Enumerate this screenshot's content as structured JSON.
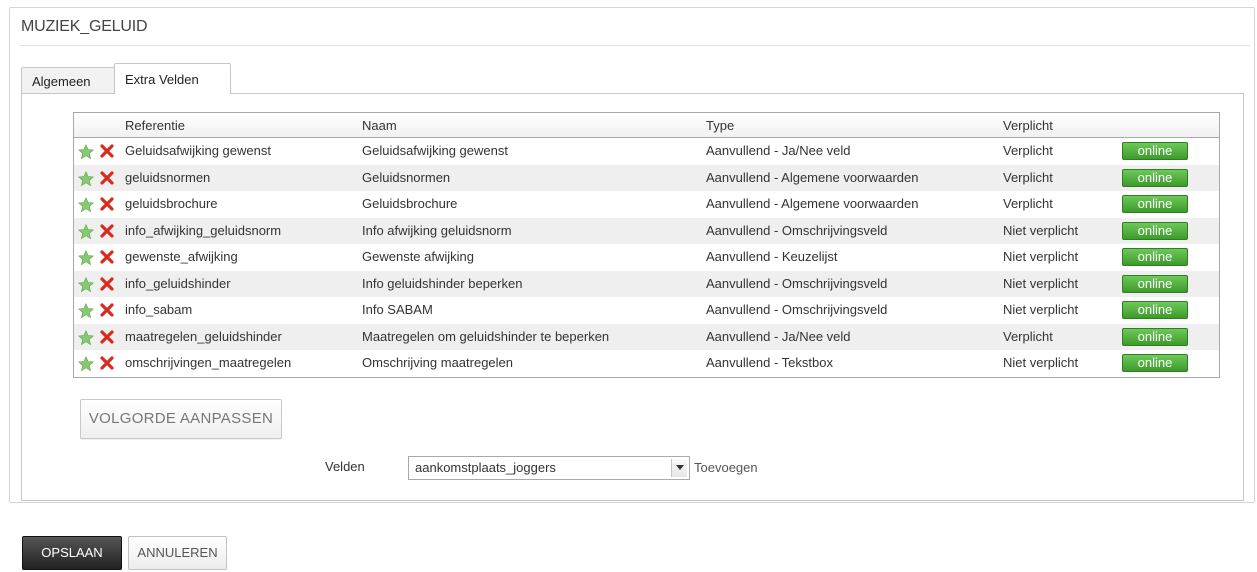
{
  "page": {
    "title": "MUZIEK_GELUID"
  },
  "tabs": [
    {
      "label": "Algemeen",
      "active": false
    },
    {
      "label": "Extra Velden",
      "active": true
    }
  ],
  "table": {
    "columns": [
      "Referentie",
      "Naam",
      "Type",
      "Verplicht"
    ],
    "online_label": "online",
    "rows": [
      {
        "ref": "Geluidsafwijking gewenst",
        "naam": "Geluidsafwijking gewenst",
        "type": "Aanvullend - Ja/Nee veld",
        "verplicht": "Verplicht"
      },
      {
        "ref": "geluidsnormen",
        "naam": "Geluidsnormen",
        "type": "Aanvullend - Algemene voorwaarden",
        "verplicht": "Verplicht"
      },
      {
        "ref": "geluidsbrochure",
        "naam": "Geluidsbrochure",
        "type": "Aanvullend - Algemene voorwaarden",
        "verplicht": "Verplicht"
      },
      {
        "ref": "info_afwijking_geluidsnorm",
        "naam": "Info afwijking geluidsnorm",
        "type": "Aanvullend - Omschrijvingsveld",
        "verplicht": "Niet verplicht"
      },
      {
        "ref": "gewenste_afwijking",
        "naam": "Gewenste afwijking",
        "type": "Aanvullend - Keuzelijst",
        "verplicht": "Niet verplicht"
      },
      {
        "ref": "info_geluidshinder",
        "naam": "Info geluidshinder beperken",
        "type": "Aanvullend - Omschrijvingsveld",
        "verplicht": "Niet verplicht"
      },
      {
        "ref": "info_sabam",
        "naam": "Info SABAM",
        "type": "Aanvullend - Omschrijvingsveld",
        "verplicht": "Niet verplicht"
      },
      {
        "ref": "maatregelen_geluidshinder",
        "naam": "Maatregelen om geluidshinder te beperken",
        "type": "Aanvullend - Ja/Nee veld",
        "verplicht": "Verplicht"
      },
      {
        "ref": "omschrijvingen_maatregelen",
        "naam": "Omschrijving maatregelen",
        "type": "Aanvullend - Tekstbox",
        "verplicht": "Niet verplicht"
      }
    ]
  },
  "order_button": {
    "label": "VOLGORDE AANPASSEN"
  },
  "fields": {
    "label": "Velden",
    "selected": "aankomstplaats_joggers",
    "add_label": "Toevoegen"
  },
  "actions": {
    "save_label": "OPSLAAN",
    "cancel_label": "ANNULEREN"
  },
  "colors": {
    "online_green": "#4caf3a",
    "delete_red": "#d32f2f",
    "star_green": "#7cc26a"
  },
  "icons": {
    "star": "star-icon",
    "delete": "close-icon",
    "dropdown": "chevron-down-icon"
  }
}
